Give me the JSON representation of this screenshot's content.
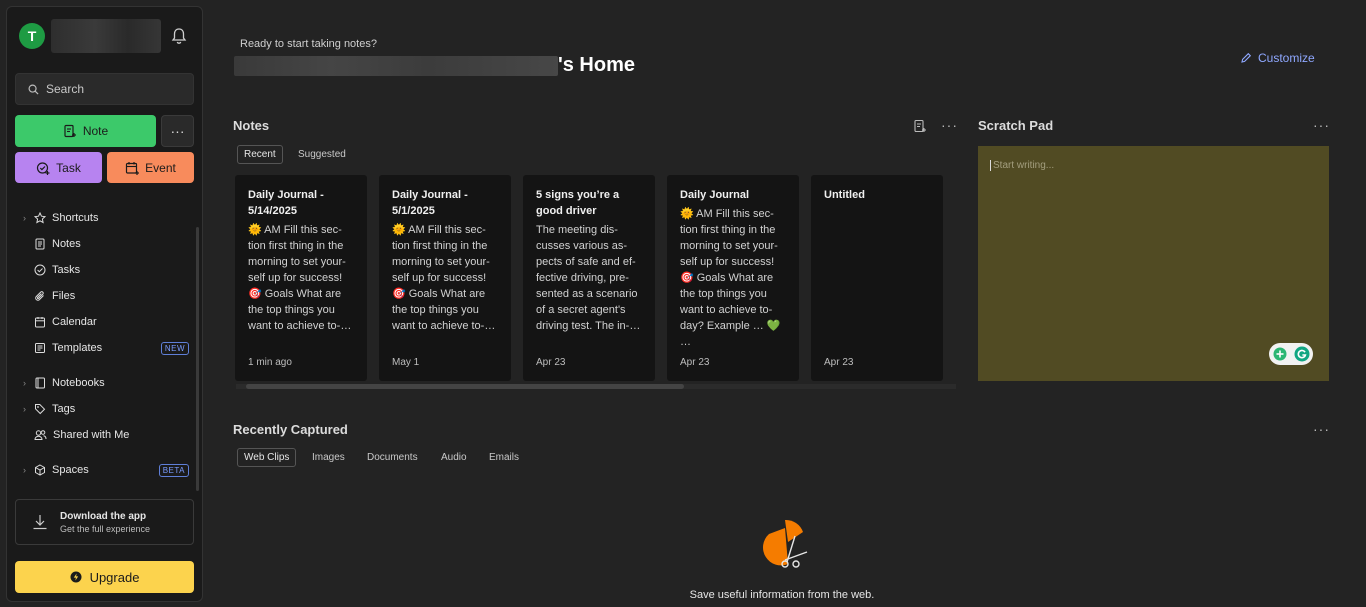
{
  "sidebar": {
    "avatar_letter": "T",
    "search_label": "Search",
    "note_label": "Note",
    "more_label": "···",
    "task_label": "Task",
    "event_label": "Event",
    "items": [
      {
        "label": "Shortcuts",
        "icon": "star-icon"
      },
      {
        "label": "Notes",
        "icon": "note-icon"
      },
      {
        "label": "Tasks",
        "icon": "task-check-icon"
      },
      {
        "label": "Files",
        "icon": "paperclip-icon"
      },
      {
        "label": "Calendar",
        "icon": "calendar-icon"
      },
      {
        "label": "Templates",
        "icon": "template-icon",
        "badge": "NEW"
      },
      {
        "label": "Notebooks",
        "icon": "notebook-icon"
      },
      {
        "label": "Tags",
        "icon": "tag-icon"
      },
      {
        "label": "Shared with Me",
        "icon": "users-icon"
      },
      {
        "label": "Spaces",
        "icon": "cube-icon",
        "badge": "BETA"
      }
    ],
    "download_title": "Download the app",
    "download_sub": "Get the full experience",
    "upgrade_label": "Upgrade"
  },
  "header": {
    "greeting": "Ready to start taking notes?",
    "home_suffix": "'s Home",
    "customize_label": "Customize"
  },
  "notes": {
    "title": "Notes",
    "tabs": [
      "Recent",
      "Suggested"
    ],
    "cards": [
      {
        "title": "Daily Journal - 5/14/2025",
        "body": "🌞 AM Fill this sec-tion first thing in the morning to set your-self up for success! 🎯 Goals What are the top things you want to achieve to-…",
        "date": "1 min ago"
      },
      {
        "title": "Daily Journal - 5/1/2025",
        "body": "🌞 AM Fill this sec-tion first thing in the morning to set your-self up for success! 🎯 Goals What are the top things you want to achieve to-…",
        "date": "May 1"
      },
      {
        "title": "5 signs you’re a good driver",
        "body": "The meeting dis-cusses various as-pects of safe and ef-fective driving, pre-sented as a scenario of a secret agent's driving test. The in-…",
        "date": "Apr 23"
      },
      {
        "title": "Daily Journal",
        "body": "🌞 AM Fill this sec-tion first thing in the morning to set your-self up for success! 🎯 Goals What are the top things you want to achieve to-day? Example … 💚 …",
        "date": "Apr 23"
      },
      {
        "title": "Untitled",
        "body": "",
        "date": "Apr 23"
      }
    ]
  },
  "scratch": {
    "title": "Scratch Pad",
    "placeholder": "Start writing..."
  },
  "captured": {
    "title": "Recently Captured",
    "tabs": [
      "Web Clips",
      "Images",
      "Documents",
      "Audio",
      "Emails"
    ],
    "empty_text": "Save useful information from the web."
  },
  "colors": {
    "note_green": "#3cc96a",
    "task_purple": "#b783f0",
    "event_orange": "#f88b5c",
    "upgrade_yellow": "#fcd34d",
    "accent_blue": "#8fa8ff",
    "scratch_bg": "#514b23"
  }
}
